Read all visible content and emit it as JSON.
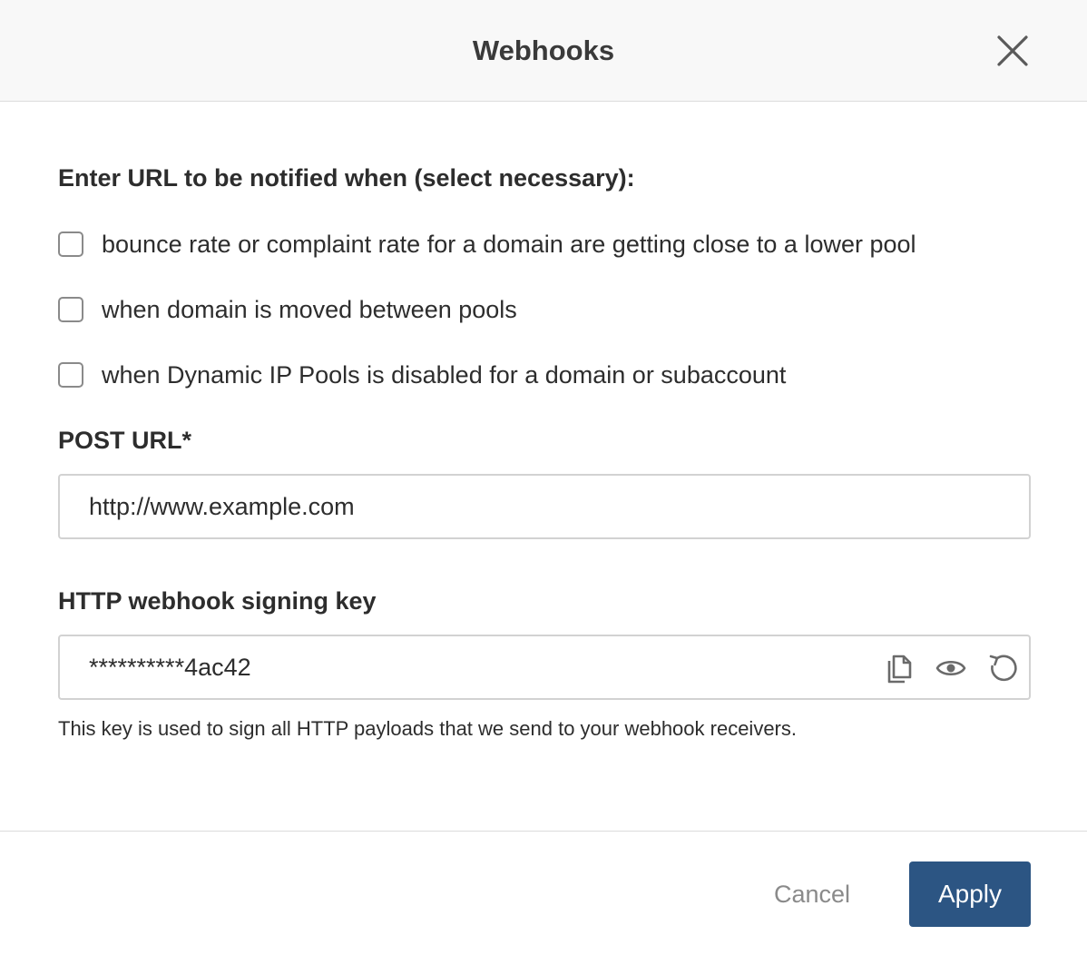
{
  "dialog": {
    "title": "Webhooks",
    "close_icon": "close-icon"
  },
  "notify": {
    "heading": "Enter URL to be notified when (select necessary):",
    "options": [
      {
        "label": "bounce rate or complaint rate for a domain are getting close to a lower pool",
        "checked": false
      },
      {
        "label": "when domain is moved between pools",
        "checked": false
      },
      {
        "label": "when Dynamic IP Pools is disabled for a domain or subaccount",
        "checked": false
      }
    ]
  },
  "post_url": {
    "label": "POST URL*",
    "value": "http://www.example.com"
  },
  "signing_key": {
    "label": "HTTP webhook signing key",
    "value": "**********4ac42",
    "icons": [
      "copy-icon",
      "eye-icon",
      "regenerate-icon"
    ],
    "helper": "This key is used to sign all HTTP payloads that we send to your webhook receivers."
  },
  "footer": {
    "cancel_label": "Cancel",
    "apply_label": "Apply"
  },
  "colors": {
    "primary": "#2c5583",
    "header_bg": "#f8f8f8",
    "border": "#d2d2d2"
  }
}
